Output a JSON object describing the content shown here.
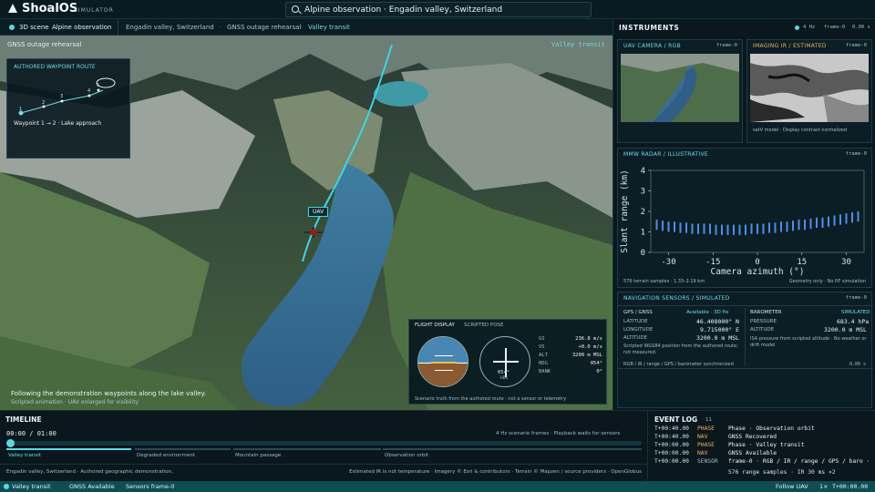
{
  "app": {
    "name": "ShoalOS",
    "sub": "SIMULATOR"
  },
  "search": {
    "value": "Alpine observation · Engadin valley, Switzerland"
  },
  "scene": {
    "tab": "3D scene",
    "tab_sub": "Alpine observation",
    "crumbs": [
      "Engadin valley, Switzerland",
      "GNSS outage rehearsal",
      "Valley transit"
    ]
  },
  "viewport": {
    "title": "GNSS outage rehearsal",
    "phase": "Valley transit",
    "uav": "UAV",
    "caption": "Following the demonstration waypoints along the lake valley.",
    "caption_sub": "Scripted animation · UAV enlarged for visibility"
  },
  "route": {
    "title": "AUTHORED WAYPOINT ROUTE",
    "label": "Waypoint 1 → 2 · Lake approach",
    "wp": [
      "1",
      "2",
      "3",
      "4",
      "5"
    ]
  },
  "flight": {
    "title": "FLIGHT DISPLAY",
    "sub": "SCRIPTED POSE",
    "rows": [
      [
        "GS",
        "236.8 m/s"
      ],
      [
        "VS",
        "+0.0 m/s"
      ],
      [
        "ALT",
        "3200 m MSL"
      ],
      [
        "HDG",
        "054°"
      ],
      [
        "BANK",
        "0°"
      ]
    ],
    "hsi_val": "054°",
    "hsi_sub": "HDG",
    "foot": "Scenario truth from the authored route · not a sensor or telemetry"
  },
  "instruments": {
    "title": "INSTRUMENTS",
    "rate": "4 Hz",
    "frame": "frame-0",
    "time": "0.00 s"
  },
  "cam": {
    "title": "UAV CAMERA / RGB",
    "frame": "frame-0"
  },
  "ir": {
    "title": "IMAGING IR / ESTIMATED",
    "frame": "frame-0",
    "note": "satV model · Display contrast normalized"
  },
  "radar": {
    "title": "MMW RADAR / ILLUSTRATIVE",
    "frame": "frame-0",
    "samples": "576 terrain samples · 1.33–2.19 km",
    "geo": "Geometry only · No RF simulation"
  },
  "chart_data": {
    "type": "bar",
    "xlabel": "Camera azimuth (°)",
    "ylabel": "Slant range (km)",
    "xlim": [
      -36,
      36
    ],
    "ylim": [
      0,
      4
    ],
    "xticks": [
      "-30",
      "-15",
      "0",
      "15",
      "30"
    ],
    "yticks": [
      "0",
      "1",
      "2",
      "3",
      "4"
    ],
    "x": [
      -34,
      -32,
      -30,
      -28,
      -26,
      -24,
      -22,
      -20,
      -18,
      -16,
      -14,
      -12,
      -10,
      -8,
      -6,
      -4,
      -2,
      0,
      2,
      4,
      6,
      8,
      10,
      12,
      14,
      16,
      18,
      20,
      22,
      24,
      26,
      28,
      30,
      32,
      34
    ],
    "values": [
      1.6,
      1.55,
      1.5,
      1.5,
      1.45,
      1.45,
      1.4,
      1.4,
      1.4,
      1.4,
      1.35,
      1.35,
      1.35,
      1.35,
      1.35,
      1.35,
      1.4,
      1.4,
      1.4,
      1.45,
      1.45,
      1.5,
      1.5,
      1.55,
      1.6,
      1.6,
      1.65,
      1.7,
      1.7,
      1.75,
      1.8,
      1.85,
      1.9,
      1.95,
      2.0
    ]
  },
  "nav": {
    "title": "NAVIGATION SENSORS / SIMULATED",
    "frame": "frame-0",
    "gps_label": "GPS / GNSS",
    "gps_status": "Available · 3D fix",
    "lat_label": "LATITUDE",
    "lat": "46.408000° N",
    "lon_label": "LONGITUDE",
    "lon": "9.715000° E",
    "alt_label": "ALTITUDE",
    "alt": "3200.0 m MSL",
    "gps_note": "Scripted WGS84 position from the authored route; not measured.",
    "baro_label": "BAROMETER",
    "baro_status": "SIMULATED",
    "press_label": "PRESSURE",
    "press": "683.4 hPa",
    "balt_label": "ALTITUDE",
    "balt": "3200.0 m MSL",
    "baro_note": "ISA pressure from scripted altitude · No weather or drift model",
    "sync": "RGB / IR / range / GPS / barometer synchronized",
    "sync_t": "0.00 s"
  },
  "timeline": {
    "title": "TIMELINE",
    "time": "00:00 / 01:00",
    "note": "4 Hz scenario frames · Playback waits for sensors",
    "phases": [
      "Valley transit",
      "Degraded environment",
      "Mountain passage",
      "Observation orbit"
    ],
    "credit_l": "Engadin valley, Switzerland · Authored geographic demonstration.",
    "credit_r": "Estimated IR is not temperature · Imagery © Esri & contributors · Terrain © Mapzen / source providers · OpenGlobus"
  },
  "log": {
    "title": "EVENT LOG",
    "count": "11",
    "rows": [
      [
        "T+00:40.00",
        "PHASE",
        "Phase · Observation orbit"
      ],
      [
        "T+00:40.00",
        "NAV",
        "GNSS Recovered"
      ],
      [
        "T+00:00.00",
        "PHASE",
        "Phase · Valley transit"
      ],
      [
        "T+00:00.00",
        "NAV",
        "GNSS Available"
      ],
      [
        "T+00:00.00",
        "SENSOR",
        "frame-0 · RGB / IR / range / GPS / baro ·"
      ]
    ],
    "cont": "576 range samples · IR 30 ms ×2"
  },
  "status": {
    "items": [
      "Valley transit",
      "GNSS Available",
      "Sensors frame-0"
    ],
    "follow": "Follow UAV",
    "speed": "1×",
    "clock": "T+00:00.00"
  },
  "colors": {
    "accent": "#5fd8e0",
    "phase": "#f0b15a",
    "nav": "#f0b15a"
  }
}
